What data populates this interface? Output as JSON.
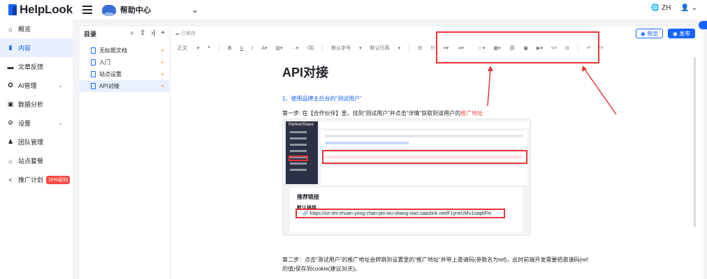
{
  "app": {
    "logo": "HelpLook",
    "site_name": "帮助中心",
    "lang": "ZH"
  },
  "sidebar": {
    "items": [
      {
        "label": "概览",
        "icon": "home-icon"
      },
      {
        "label": "内容",
        "icon": "book-icon",
        "active": true
      },
      {
        "label": "文章反馈",
        "icon": "feedback-icon"
      },
      {
        "label": "AI管理",
        "icon": "ai-icon",
        "expandable": true
      },
      {
        "label": "数据分析",
        "icon": "chart-icon"
      },
      {
        "label": "设置",
        "icon": "gear-icon",
        "expandable": true
      },
      {
        "label": "团队管理",
        "icon": "team-icon"
      },
      {
        "label": "站点套餐",
        "icon": "package-icon"
      },
      {
        "label": "推广计划",
        "icon": "share-icon",
        "badge": "10%返利"
      }
    ]
  },
  "toc": {
    "title": "目录",
    "docs": [
      {
        "label": "无标题文档"
      },
      {
        "label": "入门"
      },
      {
        "label": "站点设置"
      },
      {
        "label": "API对接",
        "active": true
      }
    ]
  },
  "editor": {
    "saved": "已保存",
    "preview": "预览",
    "publish": "发布",
    "toolbar": {
      "text_style": "正文",
      "font_size": "默认字号",
      "line_height": "默认行高"
    },
    "title": "API对接",
    "heading": "1、使用品牌主后台的“测试用户”",
    "step1_prefix": "第一步: 在【合作伙伴】里，找到“测试用户”并点击“详情”获取到该用户的",
    "step1_link": "推广地址",
    "screenshot": {
      "brand": "PartnerShare",
      "card_title": "推荐链接",
      "link_label": "默认链接",
      "link_url": "https://ce-shi-zhuan-yong-chan-pin-wu-shang-xian.saaslink.net/F1yneUMu1xaq6Fm"
    },
    "step2": "第二步：点击“测试用户”的推广地址会转跳到设置里的“推广地址”并带上邀请码(参数名为ref)，此时前端开发需要把邀请码(ref的值)保存到cookie(建议30天)。"
  }
}
